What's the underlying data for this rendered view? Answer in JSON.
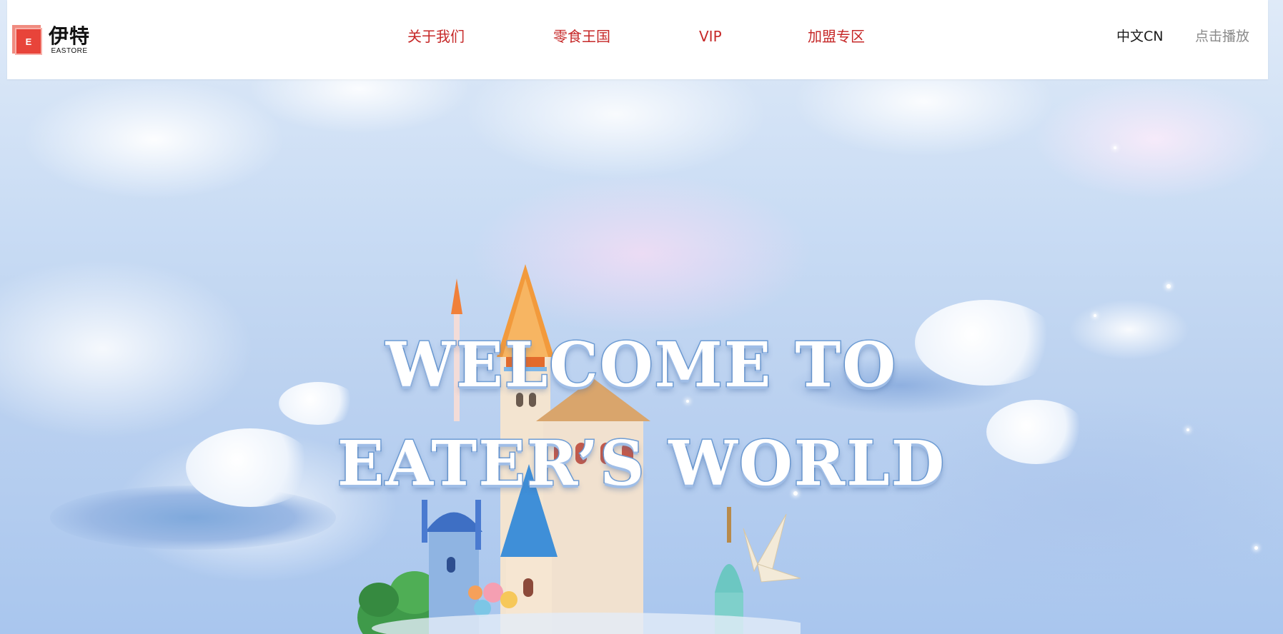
{
  "header": {
    "logo": {
      "mark_letter": "E",
      "name_cn": "伊特",
      "name_en": "EASTORE"
    },
    "nav": [
      {
        "label": "关于我们"
      },
      {
        "label": "零食王国"
      },
      {
        "label": "VIP"
      },
      {
        "label": "加盟专区"
      }
    ],
    "language_label": "中文CN",
    "play_label": "点击播放"
  },
  "hero": {
    "headline_line1": "WELCOME TO",
    "headline_line2": "EATER’S WORLD"
  },
  "colors": {
    "nav_text": "#c62828",
    "logo_red": "#e8443a",
    "headline_outline": "#6f9ed6",
    "sky_blue": "#bcd2f0"
  },
  "icons": {
    "logo_mark": "logo-e-square-icon"
  }
}
